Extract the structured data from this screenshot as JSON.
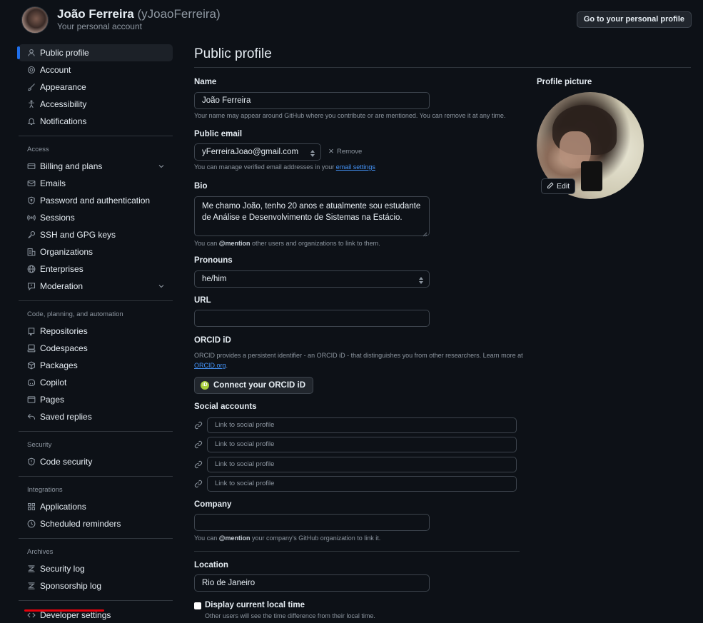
{
  "header": {
    "name": "João Ferreira",
    "login": "(yJoaoFerreira)",
    "subtitle": "Your personal account",
    "personal_profile_button": "Go to your personal profile"
  },
  "sidebar": {
    "top_items": [
      {
        "label": "Public profile",
        "icon": "person-icon",
        "active": true
      },
      {
        "label": "Account",
        "icon": "gear-icon"
      },
      {
        "label": "Appearance",
        "icon": "paintbrush-icon"
      },
      {
        "label": "Accessibility",
        "icon": "accessibility-icon"
      },
      {
        "label": "Notifications",
        "icon": "bell-icon"
      }
    ],
    "access_heading": "Access",
    "access_items": [
      {
        "label": "Billing and plans",
        "icon": "credit-card-icon",
        "expandable": true
      },
      {
        "label": "Emails",
        "icon": "mail-icon"
      },
      {
        "label": "Password and authentication",
        "icon": "shield-lock-icon"
      },
      {
        "label": "Sessions",
        "icon": "broadcast-icon"
      },
      {
        "label": "SSH and GPG keys",
        "icon": "key-icon"
      },
      {
        "label": "Organizations",
        "icon": "organization-icon"
      },
      {
        "label": "Enterprises",
        "icon": "globe-icon"
      },
      {
        "label": "Moderation",
        "icon": "report-icon",
        "expandable": true
      }
    ],
    "code_heading": "Code, planning, and automation",
    "code_items": [
      {
        "label": "Repositories",
        "icon": "repo-icon"
      },
      {
        "label": "Codespaces",
        "icon": "codespaces-icon"
      },
      {
        "label": "Packages",
        "icon": "package-icon"
      },
      {
        "label": "Copilot",
        "icon": "copilot-icon"
      },
      {
        "label": "Pages",
        "icon": "browser-icon"
      },
      {
        "label": "Saved replies",
        "icon": "reply-icon"
      }
    ],
    "security_heading": "Security",
    "security_items": [
      {
        "label": "Code security",
        "icon": "shield-icon"
      }
    ],
    "integrations_heading": "Integrations",
    "integrations_items": [
      {
        "label": "Applications",
        "icon": "apps-icon"
      },
      {
        "label": "Scheduled reminders",
        "icon": "clock-icon"
      }
    ],
    "archives_heading": "Archives",
    "archives_items": [
      {
        "label": "Security log",
        "icon": "log-icon"
      },
      {
        "label": "Sponsorship log",
        "icon": "log-icon"
      }
    ],
    "developer_settings": {
      "label": "Developer settings",
      "icon": "code-icon"
    }
  },
  "main": {
    "title": "Public profile",
    "name": {
      "label": "Name",
      "value": "João Ferreira",
      "note": "Your name may appear around GitHub where you contribute or are mentioned. You can remove it at any time."
    },
    "public_email": {
      "label": "Public email",
      "value": "yFerreiraJoao@gmail.com",
      "remove_label": "Remove",
      "note_prefix": "You can manage verified email addresses in your ",
      "note_link": "email settings"
    },
    "bio": {
      "label": "Bio",
      "value": "Me chamo João, tenho 20 anos e atualmente sou estudante de Análise e Desenvolvimento de Sistemas na Estácio.",
      "note_prefix": "You can ",
      "note_mention": "@mention",
      "note_suffix": " other users and organizations to link to them."
    },
    "pronouns": {
      "label": "Pronouns",
      "value": "he/him"
    },
    "url": {
      "label": "URL",
      "value": ""
    },
    "orcid": {
      "label": "ORCID iD",
      "note": "ORCID provides a persistent identifier - an ORCID iD - that distinguishes you from other researchers. Learn more at",
      "note_link": "ORCID.org",
      "note_end": ".",
      "button_label": "Connect your ORCID iD",
      "badge": "iD"
    },
    "social": {
      "label": "Social accounts",
      "placeholders": [
        "Link to social profile",
        "Link to social profile",
        "Link to social profile",
        "Link to social profile"
      ]
    },
    "company": {
      "label": "Company",
      "value": "",
      "note_prefix": "You can ",
      "note_mention": "@mention",
      "note_suffix": " your company's GitHub organization to link it."
    },
    "location": {
      "label": "Location",
      "value": "Rio de Janeiro"
    },
    "local_time": {
      "label": "Display current local time",
      "checked": false,
      "note": "Other users will see the time difference from their local time."
    },
    "profile_picture": {
      "label": "Profile picture",
      "edit_label": "Edit"
    }
  },
  "colors": {
    "background": "#0d1117",
    "accent": "#1f6feb",
    "link": "#4493f8",
    "annotation_underline": "#e5000b"
  }
}
